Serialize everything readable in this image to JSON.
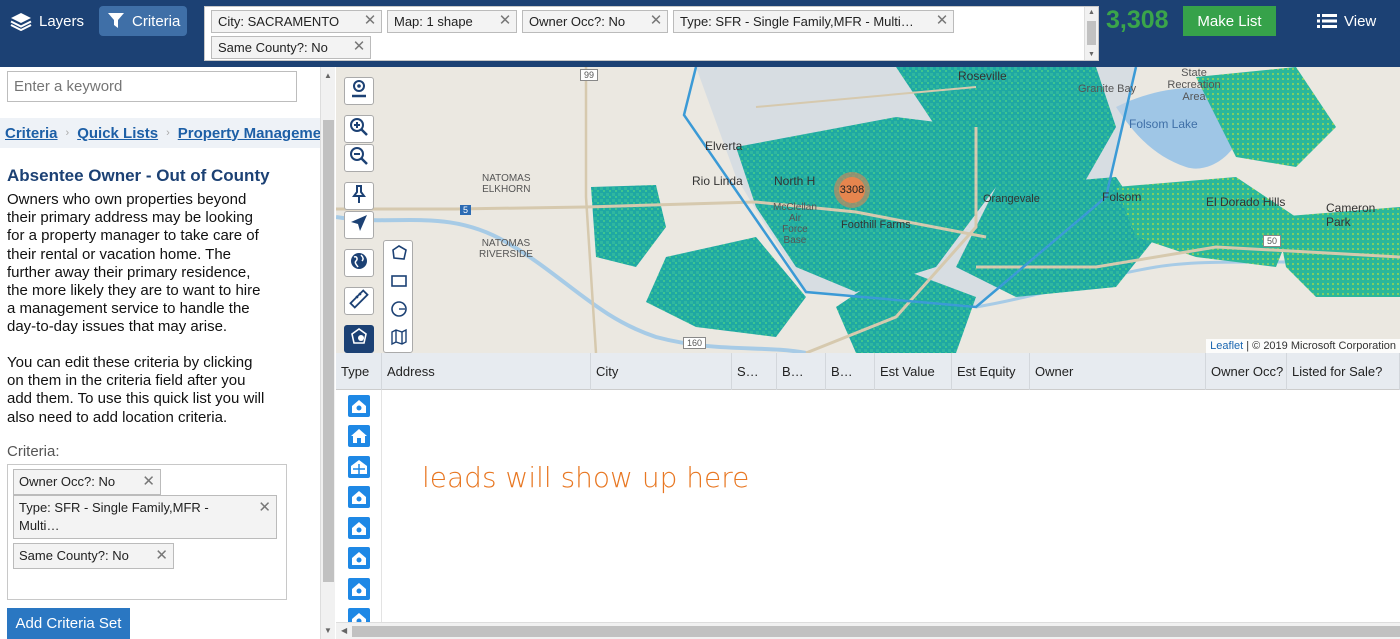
{
  "topbar": {
    "layers_label": "Layers",
    "criteria_label": "Criteria",
    "view_label": "View",
    "lead_count": "3,308",
    "make_list_label": "Make List",
    "chips": [
      {
        "label": "City: SACRAMENTO"
      },
      {
        "label": "Map: 1 shape"
      },
      {
        "label": "Owner Occ?: No"
      },
      {
        "label": "Type: SFR - Single Family,MFR - Multi…"
      },
      {
        "label": "Same County?: No"
      }
    ]
  },
  "sidebar": {
    "keyword_placeholder": "Enter a keyword",
    "breadcrumb": [
      "Criteria",
      "Quick Lists",
      "Property Manageme"
    ],
    "title": "Absentee Owner - Out of County",
    "description": "Owners who own properties beyond their primary address may be looking for a property manager to take care of their rental or vacation home. The further away their primary residence, the more likely they are to want to hire a management service to handle the day-to-day issues that may arise.",
    "description2": "You can edit these criteria by clicking on them in the criteria field after you add them. To use this quick list you will also need to add location criteria.",
    "criteria_label": "Criteria:",
    "chips": [
      {
        "label": "Owner Occ?: No"
      },
      {
        "label": "Type: SFR - Single Family,MFR - Multi…"
      },
      {
        "label": "Same County?: No"
      }
    ],
    "add_button_label": "Add Criteria Set"
  },
  "map": {
    "cluster_count": "3308",
    "attribution_link": "Leaflet",
    "attribution_text": " | © 2019 Microsoft Corporation",
    "labels": {
      "roseville": "Roseville",
      "state_recreation_area": "State\nRecreation\nArea",
      "granite_bay": "Granite Bay",
      "folsom_lake": "Folsom Lake",
      "elverta": "Elverta",
      "rio_linda": "Rio Linda",
      "north_highlands": "North H",
      "natomas_elkhorn": "NATOMAS\nELKHORN",
      "natomas_riverside": "NATOMAS\nRIVERSIDE",
      "mcclellan": "McClellan\nAir\nForce\nBase",
      "foothill_farms": "Foothill Farms",
      "orangevale": "Orangevale",
      "folsom": "Folsom",
      "el_dorado_hills": "El Dorado Hills",
      "cameron_park": "Cameron Park",
      "highway_99": "99",
      "highway_5": "5",
      "highway_160": "160",
      "highway_50": "50"
    }
  },
  "table": {
    "columns": [
      "Type",
      "Address",
      "City",
      "S…",
      "B…",
      "B…",
      "Est Value",
      "Est Equity",
      "Owner",
      "Owner Occ?",
      "Listed for Sale?"
    ],
    "placeholder": "leads will show up here",
    "row_icons": [
      "home-alt-icon",
      "home-icon",
      "multi-family-icon",
      "home-alt-icon",
      "home-alt-icon",
      "home-alt-icon",
      "home-alt-icon",
      "home-alt-icon"
    ]
  },
  "colors": {
    "topbar": "#1c4174",
    "accent_green": "#36a24a",
    "link_blue": "#1d5fa6",
    "leads_orange": "#e87722",
    "cluster": "#e6854e"
  }
}
